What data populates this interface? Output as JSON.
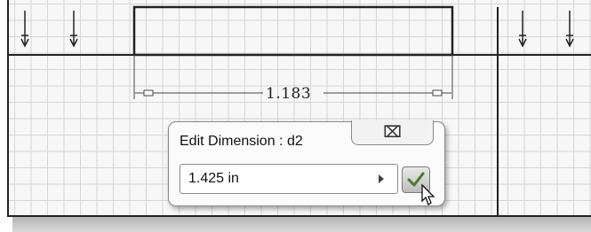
{
  "dimension": {
    "value_label": "1.183"
  },
  "dialog": {
    "title": "Edit Dimension : d2",
    "close_icon": "close-icon",
    "value": "1.425 in",
    "accept_icon": "checkmark-icon"
  },
  "icons": {
    "pointer": "mouse-pointer-icon",
    "menu": "triangle-right-icon"
  },
  "colors": {
    "line": "#222222",
    "grid": "#d6d6d6",
    "background": "#f7f7f7",
    "accept_check": "#4a7a2a"
  }
}
